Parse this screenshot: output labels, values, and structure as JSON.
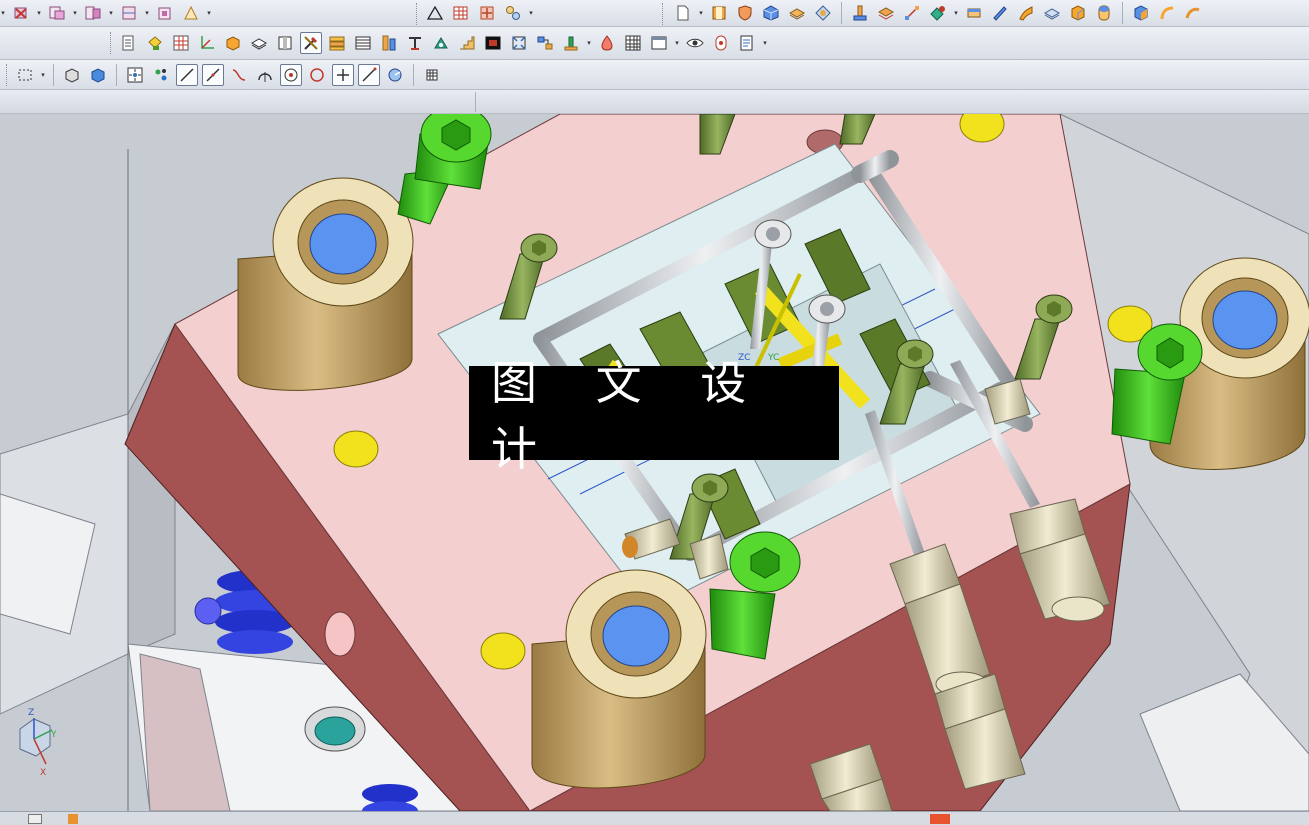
{
  "watermark": {
    "text": "图 文 设 计"
  },
  "triad": {
    "z_label": "Z",
    "y_label": "Y",
    "x_label": "X"
  },
  "wcs": {
    "zc_label": "ZC",
    "yc_label": "YC"
  },
  "colors": {
    "plate_top": "#f4cfcf",
    "plate_side": "#a55252",
    "bushing": "#c9ad74",
    "bushing_hole": "#5b93f0",
    "bolt_green": "#39c11a",
    "bolt_olive": "#6e8b3d",
    "pin_yellow": "#f2e21d",
    "insert_plate": "#dfeef0",
    "fitting": "#d8d2b4",
    "rail_gray": "#d7d9dc"
  },
  "toolbars": {
    "row1": [
      "assembly-icon",
      "delete-component-icon",
      "new-parent-icon",
      "add-component-icon",
      "mirror-assembly-icon",
      "reposition-icon",
      "array-icon",
      "triangle-icon",
      "table-icon",
      "move-icon",
      "constraint-icon",
      "new-file-icon",
      "book-icon",
      "shield-icon",
      "cube-icon",
      "sheet-icon",
      "orient-icon",
      "pin-icon",
      "layer-icon",
      "coord-icon",
      "shape-icon",
      "block-icon",
      "blend-icon",
      "surface-icon",
      "layers-icon",
      "box-icon",
      "tube-icon",
      "prism-icon",
      "curve-icon",
      "arc-icon"
    ],
    "row2": [
      "list-icon",
      "paint-icon",
      "grid-icon",
      "axis-icon",
      "solid-icon",
      "layer-view-icon",
      "frame-icon",
      "tools-icon",
      "stack-icon",
      "screen-icon",
      "spring-icon",
      "text-icon",
      "mold-icon",
      "step-icon",
      "film-icon",
      "crosshair-icon",
      "connect-icon",
      "stand-icon",
      "drop-icon",
      "grid2-icon",
      "window-icon",
      "eye-icon",
      "refresh-icon",
      "document-icon"
    ],
    "row3": [
      "select-box-icon",
      "shade-icon",
      "cube-blue-icon",
      "snap-icon",
      "move-point-icon",
      "line-icon",
      "line2-icon",
      "spline-icon",
      "arc-tool-icon",
      "circle-point-icon",
      "circle-icon",
      "plus-icon",
      "diagonal-icon",
      "rotate-icon",
      "grid-small-icon"
    ]
  }
}
